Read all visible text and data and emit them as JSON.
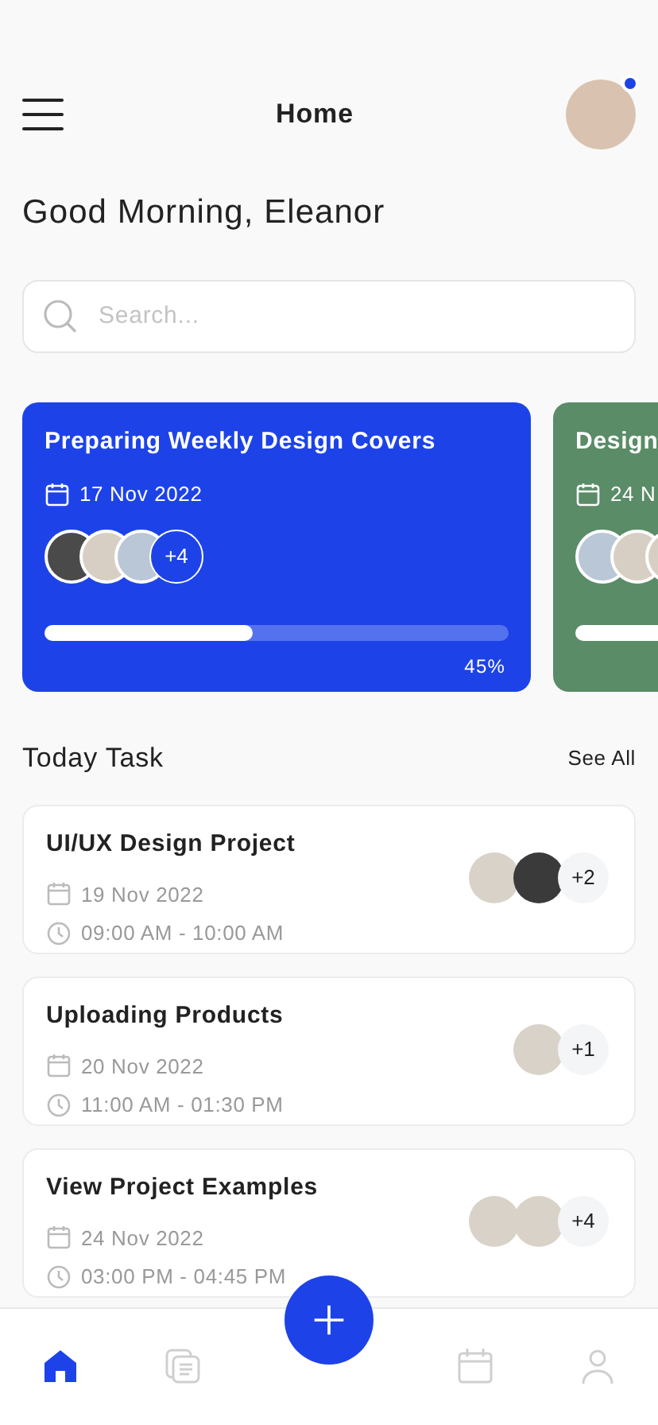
{
  "header": {
    "title": "Home",
    "has_notification": true
  },
  "greeting": "Good Morning, Eleanor",
  "search": {
    "placeholder": "Search..."
  },
  "projects": [
    {
      "title": "Preparing Weekly Design Covers",
      "date": "17 Nov 2022",
      "extra": "+4",
      "avatars": [
        {
          "kind": "dark"
        },
        {
          "kind": "light"
        },
        {
          "kind": "blue"
        }
      ],
      "level": 0.45,
      "reading": "45%",
      "color": "#1d43e8"
    },
    {
      "title": "Design",
      "date": "24 N",
      "avatars": [
        {
          "kind": "blue"
        },
        {
          "kind": "light"
        },
        {
          "kind": "light"
        }
      ],
      "color": "#5a8c67"
    }
  ],
  "today": {
    "title": "Today Task",
    "link": "See All"
  },
  "tasks": [
    {
      "title": "UI/UX Design Project",
      "date": "19 Nov 2022",
      "time": "09:00 AM - 10:00 AM",
      "avatars": [
        {
          "kind": "light"
        },
        {
          "kind": "dark"
        }
      ],
      "extra": "+2"
    },
    {
      "title": "Uploading Products",
      "date": "20 Nov 2022",
      "time": "11:00 AM - 01:30 PM",
      "avatars": [
        {
          "kind": "light"
        }
      ],
      "extra": "+1"
    },
    {
      "title": "View Project Examples",
      "date": "24 Nov 2022",
      "time": "03:00 PM - 04:45 PM",
      "avatars": [
        {
          "kind": "light"
        },
        {
          "kind": "light"
        }
      ],
      "extra": "+4"
    }
  ],
  "nav": [
    {
      "kind": "home",
      "selected": true
    },
    {
      "kind": "documents",
      "selected": false
    },
    {
      "kind": "add"
    },
    {
      "kind": "calendar",
      "selected": false
    },
    {
      "kind": "profile",
      "selected": false
    }
  ]
}
